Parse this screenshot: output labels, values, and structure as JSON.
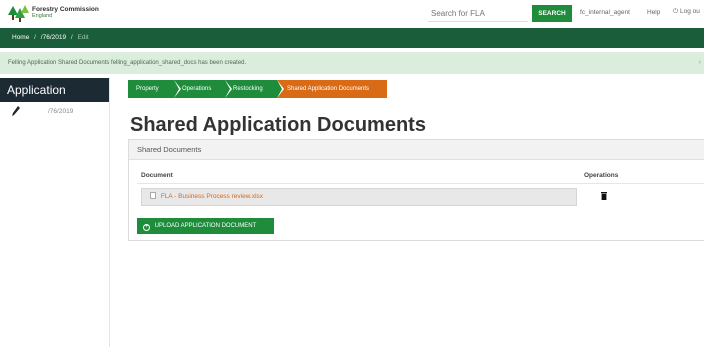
{
  "header": {
    "logo_line1": "Forestry Commission",
    "logo_line2": "England",
    "search_placeholder": "Search for FLA",
    "search_button": "SEARCH",
    "user": "fc_internal_agent",
    "help": "Help",
    "logout": "Log ou",
    "accent": "#1e8c3a"
  },
  "breadcrumb": {
    "home": "Home",
    "sep": "/",
    "case": "/76/2019",
    "current": "Edit"
  },
  "alert": {
    "message": "Felling Application Shared Documents felling_application_shared_docs has been created.",
    "close": "›"
  },
  "sidebar": {
    "title": "Application",
    "item_text": "/76/2019",
    "item_icon": "pencil-icon"
  },
  "steps": {
    "property": "Property",
    "operations": "Operations",
    "restocking": "Restocking",
    "shared": "Shared Application Documents",
    "active_color": "#d96b16"
  },
  "main": {
    "title": "Shared Application Documents",
    "panel_title": "Shared Documents",
    "col_document": "Document",
    "col_operations": "Operations",
    "document_name": "FLA - Business Process review.xlsx",
    "upload_label": "UPLOAD APPLICATION DOCUMENT"
  }
}
